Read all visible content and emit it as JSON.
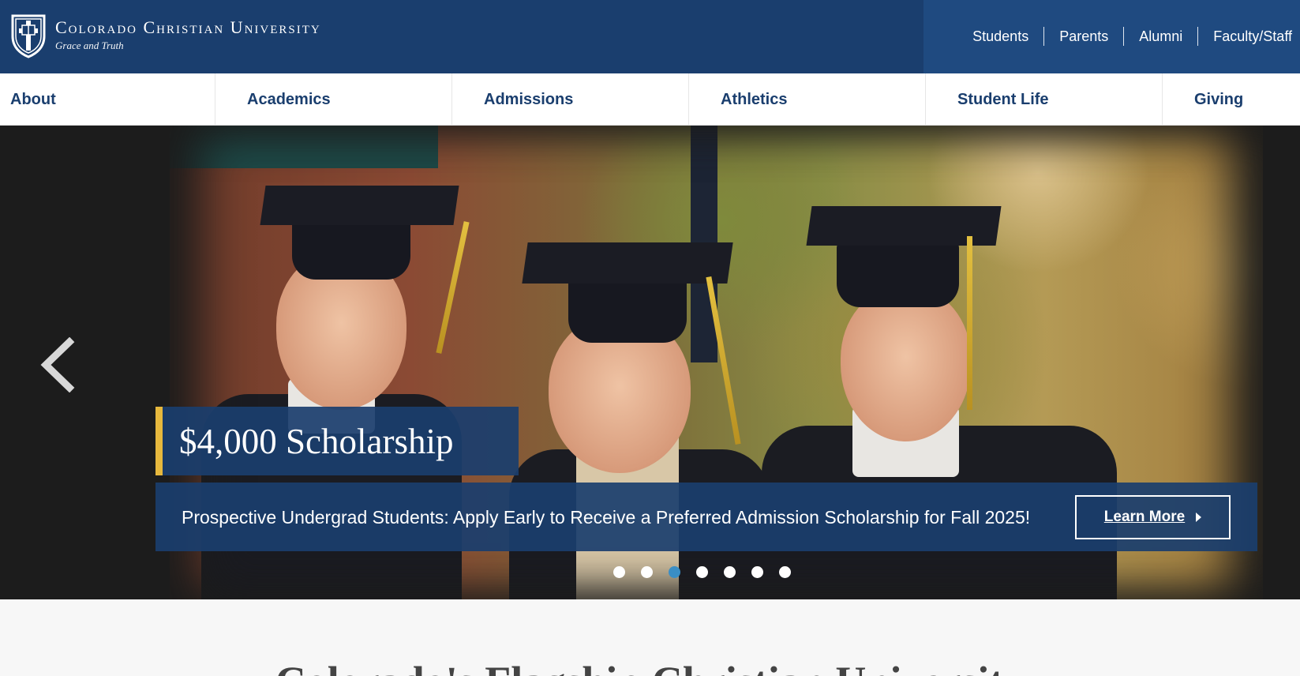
{
  "brand": {
    "name": "Colorado Christian University",
    "tagline": "Grace and Truth"
  },
  "audience_links": [
    "Students",
    "Parents",
    "Alumni",
    "Faculty/Staff"
  ],
  "main_nav": [
    "About",
    "Academics",
    "Admissions",
    "Athletics",
    "Student Life",
    "Giving"
  ],
  "hero": {
    "headline": "$4,000 Scholarship",
    "subtext": "Prospective Undergrad Students: Apply Early to Receive a Preferred Admission Scholarship for Fall 2025!",
    "cta_label": "Learn More",
    "slide_count": 7,
    "active_slide": 3
  },
  "section": {
    "title": "Colorado's Flagship Christian University"
  },
  "colors": {
    "primary": "#1a3e6e",
    "accent": "#e6b83d",
    "active_dot": "#3a8ec5"
  },
  "icons": {
    "logo": "shield-crest-icon",
    "prev": "chevron-left-icon",
    "cta": "caret-right-icon"
  }
}
